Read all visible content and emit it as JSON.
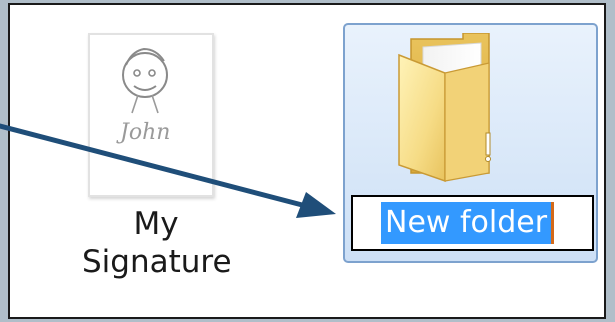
{
  "explorer": {
    "items": [
      {
        "label_line1": "My",
        "label_line2": "Signature",
        "icon": "signature-image-thumbnail",
        "thumbnail_text": "John"
      },
      {
        "icon": "folder-icon",
        "rename_value": "New folder",
        "selected": true,
        "editing": true
      }
    ]
  },
  "annotation": {
    "icon": "arrow-pointer",
    "color": "#1f4e79"
  },
  "colors": {
    "selection_background": "#3399ff",
    "item_selected_border": "#7da2ce",
    "background": "#b0bec9"
  }
}
